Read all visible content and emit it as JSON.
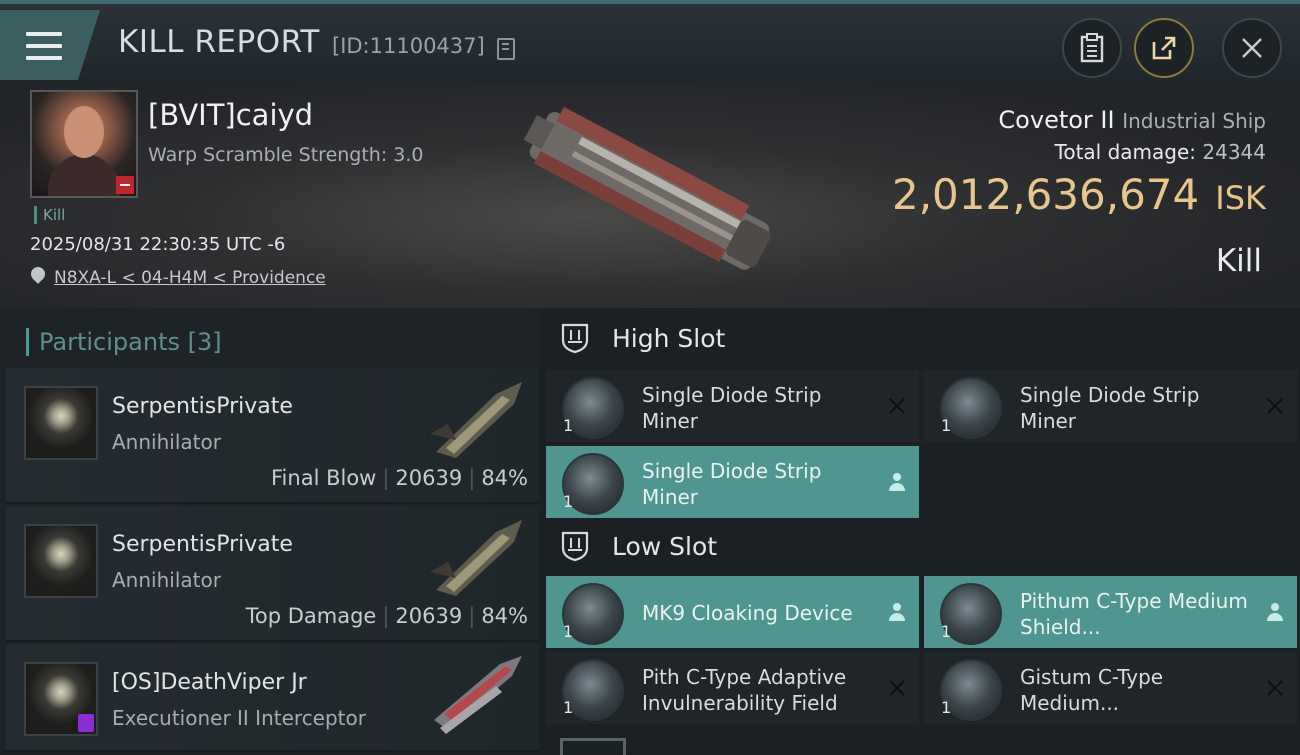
{
  "header": {
    "title": "KILL REPORT",
    "report_id": "[ID:11100437]"
  },
  "victim": {
    "name": "[BVIT]caiyd",
    "warp_scramble": "Warp Scramble Strength: 3.0",
    "tag": "Kill",
    "datetime": "2025/08/31 22:30:35 UTC -6",
    "location": "N8XA-L < 04-H4M < Providence"
  },
  "ship": {
    "name": "Covetor II",
    "class": "Industrial Ship",
    "total_damage_label": "Total damage:",
    "total_damage": "24344",
    "isk_value": "2,012,636,674",
    "isk_unit": "ISK",
    "result": "Kill"
  },
  "participants": {
    "header": "Participants",
    "count": "[3]",
    "items": [
      {
        "name": "SerpentisPrivate",
        "ship": "Annihilator",
        "role": "Final Blow",
        "damage": "20639",
        "percent": "84%"
      },
      {
        "name": "SerpentisPrivate",
        "ship": "Annihilator",
        "role": "Top Damage",
        "damage": "20639",
        "percent": "84%"
      },
      {
        "name": "[OS]DeathViper Jr",
        "ship": "Executioner II Interceptor",
        "role": "",
        "damage": "",
        "percent": ""
      }
    ]
  },
  "slots": {
    "high": {
      "title": "High Slot",
      "items": [
        {
          "name": "Single Diode Strip Miner",
          "qty": "1",
          "state": "destroyed"
        },
        {
          "name": "Single Diode Strip Miner",
          "qty": "1",
          "state": "destroyed"
        },
        {
          "name": "Single Diode Strip Miner",
          "qty": "1",
          "state": "dropped"
        }
      ]
    },
    "low": {
      "title": "Low Slot",
      "items": [
        {
          "name": "MK9 Cloaking Device",
          "qty": "1",
          "state": "dropped"
        },
        {
          "name": "Pithum C-Type Medium Shield...",
          "qty": "1",
          "state": "dropped"
        },
        {
          "name": "Pith C-Type Adaptive Invulnerability Field",
          "qty": "1",
          "state": "destroyed"
        },
        {
          "name": "Gistum C-Type Medium...",
          "qty": "1",
          "state": "destroyed"
        }
      ]
    }
  },
  "colors": {
    "accent_teal": "#4f9690",
    "isk_gold": "#e6c68a",
    "security_badge": "#c0262b"
  }
}
